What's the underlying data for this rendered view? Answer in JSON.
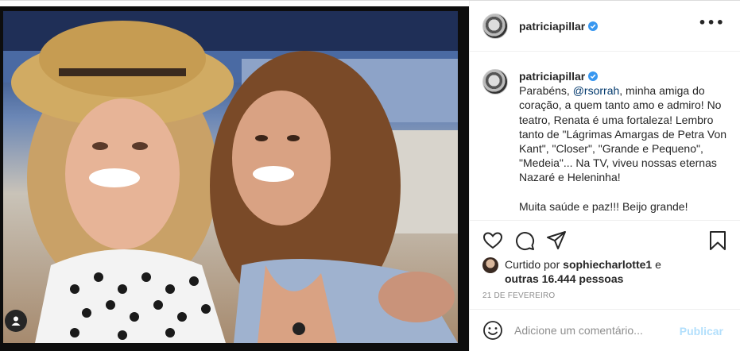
{
  "header": {
    "username": "patriciapillar",
    "more_label": "•••"
  },
  "caption": {
    "username": "patriciapillar",
    "text_before": "Parabéns, ",
    "mention": "@rsorrah",
    "text_after": ", minha amiga do coração, a quem tanto amo e admiro! No teatro, Renata é uma fortaleza! Lembro tanto de \"Lágrimas Amargas de Petra Von Kant\", \"Closer\", \"Grande e Pequeno\", \"Medeia\"... Na TV, viveu nossas eternas Nazaré e Heleninha!",
    "paragraph2": "Muita saúde e paz!!! Beijo grande!"
  },
  "likes": {
    "prefix": "Curtido por ",
    "user": "sophiecharlotte1",
    "middle": " e",
    "others": "outras 16.444 pessoas"
  },
  "date": "21 DE FEVEREIRO",
  "comment": {
    "placeholder": "Adicione um comentário...",
    "publish_label": "Publicar"
  },
  "icons": {
    "like": "heart-icon",
    "comment": "comment-icon",
    "share": "share-icon",
    "save": "bookmark-icon",
    "verified": "verified-badge-icon",
    "emoji": "emoji-icon",
    "tagged": "user-tag-icon"
  },
  "colors": {
    "verified": "#3897f0",
    "mention": "#00376b",
    "publish_disabled": "#b2dffc",
    "muted": "#8e8e8e"
  }
}
